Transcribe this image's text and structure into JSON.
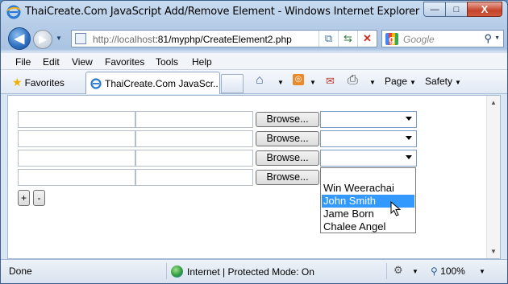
{
  "window": {
    "title": "ThaiCreate.Com JavaScript Add/Remove Element - Windows Internet Explorer",
    "controls": {
      "minimize": "—",
      "maximize": "□",
      "close": "X"
    }
  },
  "navbar": {
    "url_host": "http://localhost",
    "url_path": ":81/myphp/CreateElement2.php",
    "search_placeholder": "Google"
  },
  "menu": {
    "items": [
      "File",
      "Edit",
      "View",
      "Favorites",
      "Tools",
      "Help"
    ]
  },
  "commandbar": {
    "favorites": "Favorites",
    "tab_title": "ThaiCreate.Com JavaScr...",
    "page": "Page",
    "safety": "Safety"
  },
  "form": {
    "browse_label": "Browse...",
    "add_label": "+",
    "remove_label": "-",
    "dropdown_options": [
      "",
      "Win Weerachai",
      "John  Smith",
      "Jame Born",
      "Chalee Angel"
    ],
    "highlighted_option": "John  Smith"
  },
  "status": {
    "text": "Done",
    "zone": "Internet | Protected Mode: On",
    "zoom": "100%"
  },
  "colors": {
    "selection": "#3399ff",
    "titlebar": "#b6cde8"
  }
}
